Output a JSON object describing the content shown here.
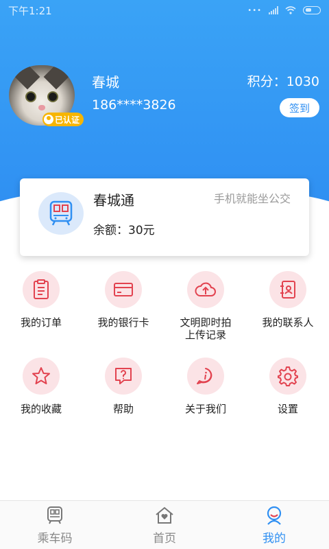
{
  "status_bar": {
    "time": "下午1:21"
  },
  "user": {
    "name": "春城",
    "phone": "186****3826",
    "points": "积分：1030",
    "verified_badge": "已认证",
    "signin_label": "签到"
  },
  "card": {
    "title": "春城通",
    "slogan": "手机就能坐公交",
    "balance": "余额：30元"
  },
  "menu": [
    {
      "label": "我的订单",
      "icon": "clipboard-icon"
    },
    {
      "label": "我的银行卡",
      "icon": "bank-card-icon"
    },
    {
      "label": "文明即时拍\n上传记录",
      "icon": "cloud-upload-icon"
    },
    {
      "label": "我的联系人",
      "icon": "contacts-icon"
    },
    {
      "label": "我的收藏",
      "icon": "star-icon"
    },
    {
      "label": "帮助",
      "icon": "help-icon"
    },
    {
      "label": "关于我们",
      "icon": "info-icon"
    },
    {
      "label": "设置",
      "icon": "gear-icon"
    }
  ],
  "tabs": [
    {
      "label": "乘车码",
      "icon": "bus-icon",
      "active": false
    },
    {
      "label": "首页",
      "icon": "home-icon",
      "active": false
    },
    {
      "label": "我的",
      "icon": "profile-icon",
      "active": true
    }
  ],
  "colors": {
    "primary": "#2f8ff2",
    "menu_icon_bg": "#fbe3e6",
    "menu_icon_stroke": "#e2424f",
    "badge": "#f7b500"
  }
}
